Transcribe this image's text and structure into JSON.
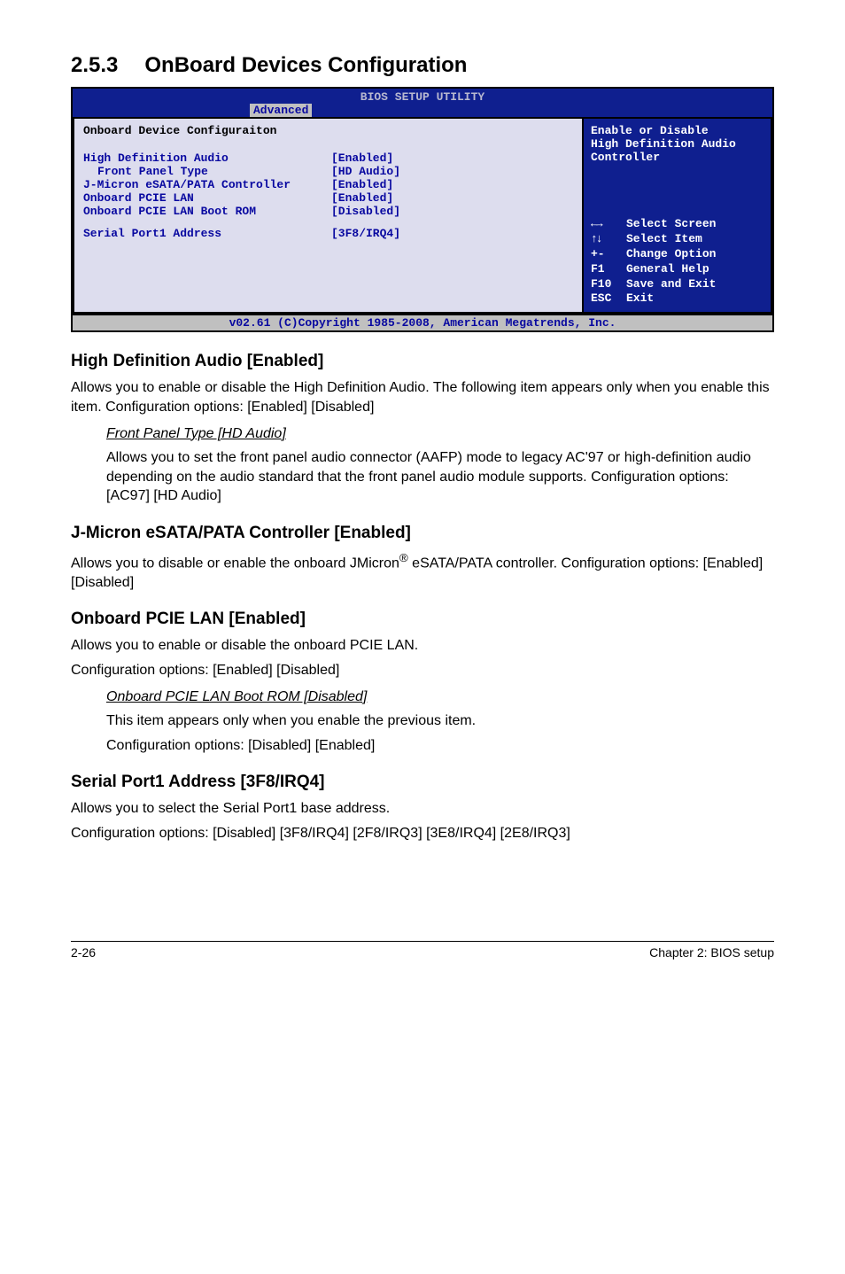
{
  "section": {
    "number": "2.5.3",
    "title": "OnBoard Devices Configuration"
  },
  "bios": {
    "header": "BIOS SETUP UTILITY",
    "tab": "Advanced",
    "left_title": "Onboard Device Configuraiton",
    "rows": [
      {
        "label": "High Definition Audio",
        "value": "[Enabled]",
        "indent": false
      },
      {
        "label": "Front Panel Type",
        "value": "[HD Audio]",
        "indent": true
      },
      {
        "label": "J-Micron eSATA/PATA Controller",
        "value": "[Enabled]",
        "indent": false
      },
      {
        "label": "Onboard PCIE LAN",
        "value": "[Enabled]",
        "indent": false
      },
      {
        "label": "Onboard PCIE LAN Boot ROM",
        "value": "[Disabled]",
        "indent": false
      }
    ],
    "serial_row": {
      "label": "Serial Port1 Address",
      "value": "[3F8/IRQ4]"
    },
    "help_line1": "Enable or Disable",
    "help_line2": "High Definition Audio",
    "help_line3": "Controller",
    "nav": [
      {
        "key": "←→",
        "desc": "Select Screen"
      },
      {
        "key": "↑↓",
        "desc": "Select Item"
      },
      {
        "key": "+-",
        "desc": "Change Option"
      },
      {
        "key": "F1",
        "desc": "General Help"
      },
      {
        "key": "F10",
        "desc": "Save and Exit"
      },
      {
        "key": "ESC",
        "desc": "Exit"
      }
    ],
    "footer": "v02.61 (C)Copyright 1985-2008, American Megatrends, Inc."
  },
  "s1": {
    "heading": "High Definition Audio [Enabled]",
    "p1": "Allows you to enable or disable the High Definition Audio. The following item appears only when you enable this item. Configuration options: [Enabled] [Disabled]",
    "sub_title": "Front Panel Type [HD Audio]",
    "sub_body": "Allows you to set the front panel audio connector (AAFP) mode to legacy AC'97 or high-definition audio depending on the audio standard that the front panel audio module supports. Configuration options: [AC97] [HD Audio]"
  },
  "s2": {
    "heading": "J-Micron eSATA/PATA Controller [Enabled]",
    "p1a": "Allows you to disable or enable the onboard JMicron",
    "p1b": " eSATA/PATA controller. Configuration options: [Enabled] [Disabled]"
  },
  "s3": {
    "heading": "Onboard PCIE LAN [Enabled]",
    "p1": "Allows you to enable or disable the onboard PCIE LAN.",
    "p2": "Configuration options: [Enabled] [Disabled]",
    "sub_title": "Onboard PCIE LAN Boot ROM [Disabled]",
    "sub_l1": "This item appears only when you enable the previous item.",
    "sub_l2": "Configuration options: [Disabled] [Enabled]"
  },
  "s4": {
    "heading": "Serial Port1 Address [3F8/IRQ4]",
    "p1": "Allows you to select the Serial Port1 base address.",
    "p2": "Configuration options: [Disabled] [3F8/IRQ4] [2F8/IRQ3] [3E8/IRQ4] [2E8/IRQ3]"
  },
  "footer": {
    "left": "2-26",
    "right": "Chapter 2: BIOS setup"
  }
}
